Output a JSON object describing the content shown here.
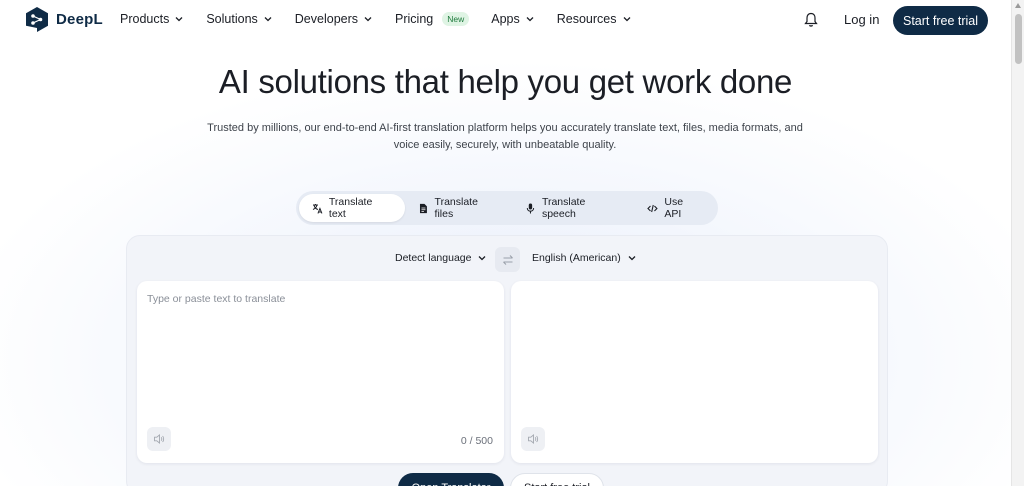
{
  "nav": {
    "logo_text": "DeepL",
    "items": [
      {
        "label": "Products",
        "has_chevron": true
      },
      {
        "label": "Solutions",
        "has_chevron": true
      },
      {
        "label": "Developers",
        "has_chevron": true
      },
      {
        "label": "Pricing",
        "badge": "New"
      },
      {
        "label": "Apps",
        "has_chevron": true
      },
      {
        "label": "Resources",
        "has_chevron": true
      }
    ],
    "bell_icon": "bell-icon",
    "login_label": "Log in",
    "cta_label": "Start free trial"
  },
  "hero": {
    "title": "AI solutions that help you get work done",
    "subtitle": "Trusted by millions, our end-to-end AI-first translation platform helps you accurately translate text, files, media formats, and voice easily, securely, with unbeatable quality."
  },
  "tabs": [
    {
      "label": "Translate text",
      "icon": "translate-icon",
      "active": true
    },
    {
      "label": "Translate files",
      "icon": "file-icon",
      "active": false
    },
    {
      "label": "Translate speech",
      "icon": "microphone-icon",
      "active": false
    },
    {
      "label": "Use API",
      "icon": "code-icon",
      "active": false
    }
  ],
  "translator": {
    "source_language": "Detect language",
    "target_language": "English (American)",
    "source_placeholder": "Type or paste text to translate",
    "source_value": "",
    "char_count": "0 / 500"
  },
  "bottom_buttons": {
    "open_label": "Open Translator",
    "trial_label": "Start free trial"
  },
  "colors": {
    "brand_navy": "#0f2b46",
    "new_badge_bg": "#dff4e4",
    "new_badge_text": "#1e7a3c"
  }
}
